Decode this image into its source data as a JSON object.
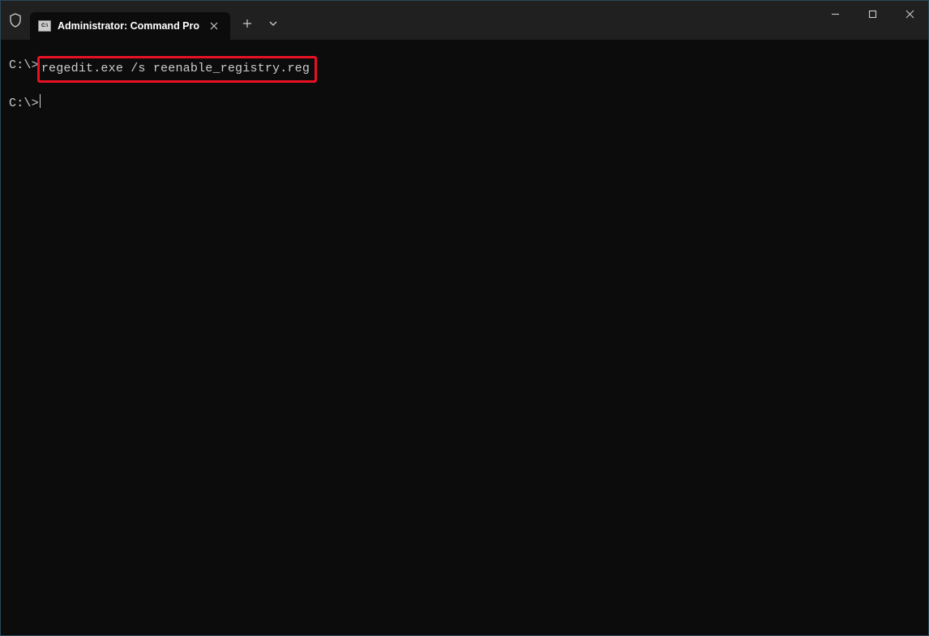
{
  "titlebar": {
    "tab_title": "Administrator: Command Pro",
    "tab_icon_label": "C:\\"
  },
  "terminal": {
    "lines": [
      {
        "prompt": "C:\\>",
        "command": "regedit.exe /s reenable_registry.reg",
        "highlighted": true
      },
      {
        "prompt": "C:\\>",
        "command": "",
        "cursor": true
      }
    ]
  }
}
